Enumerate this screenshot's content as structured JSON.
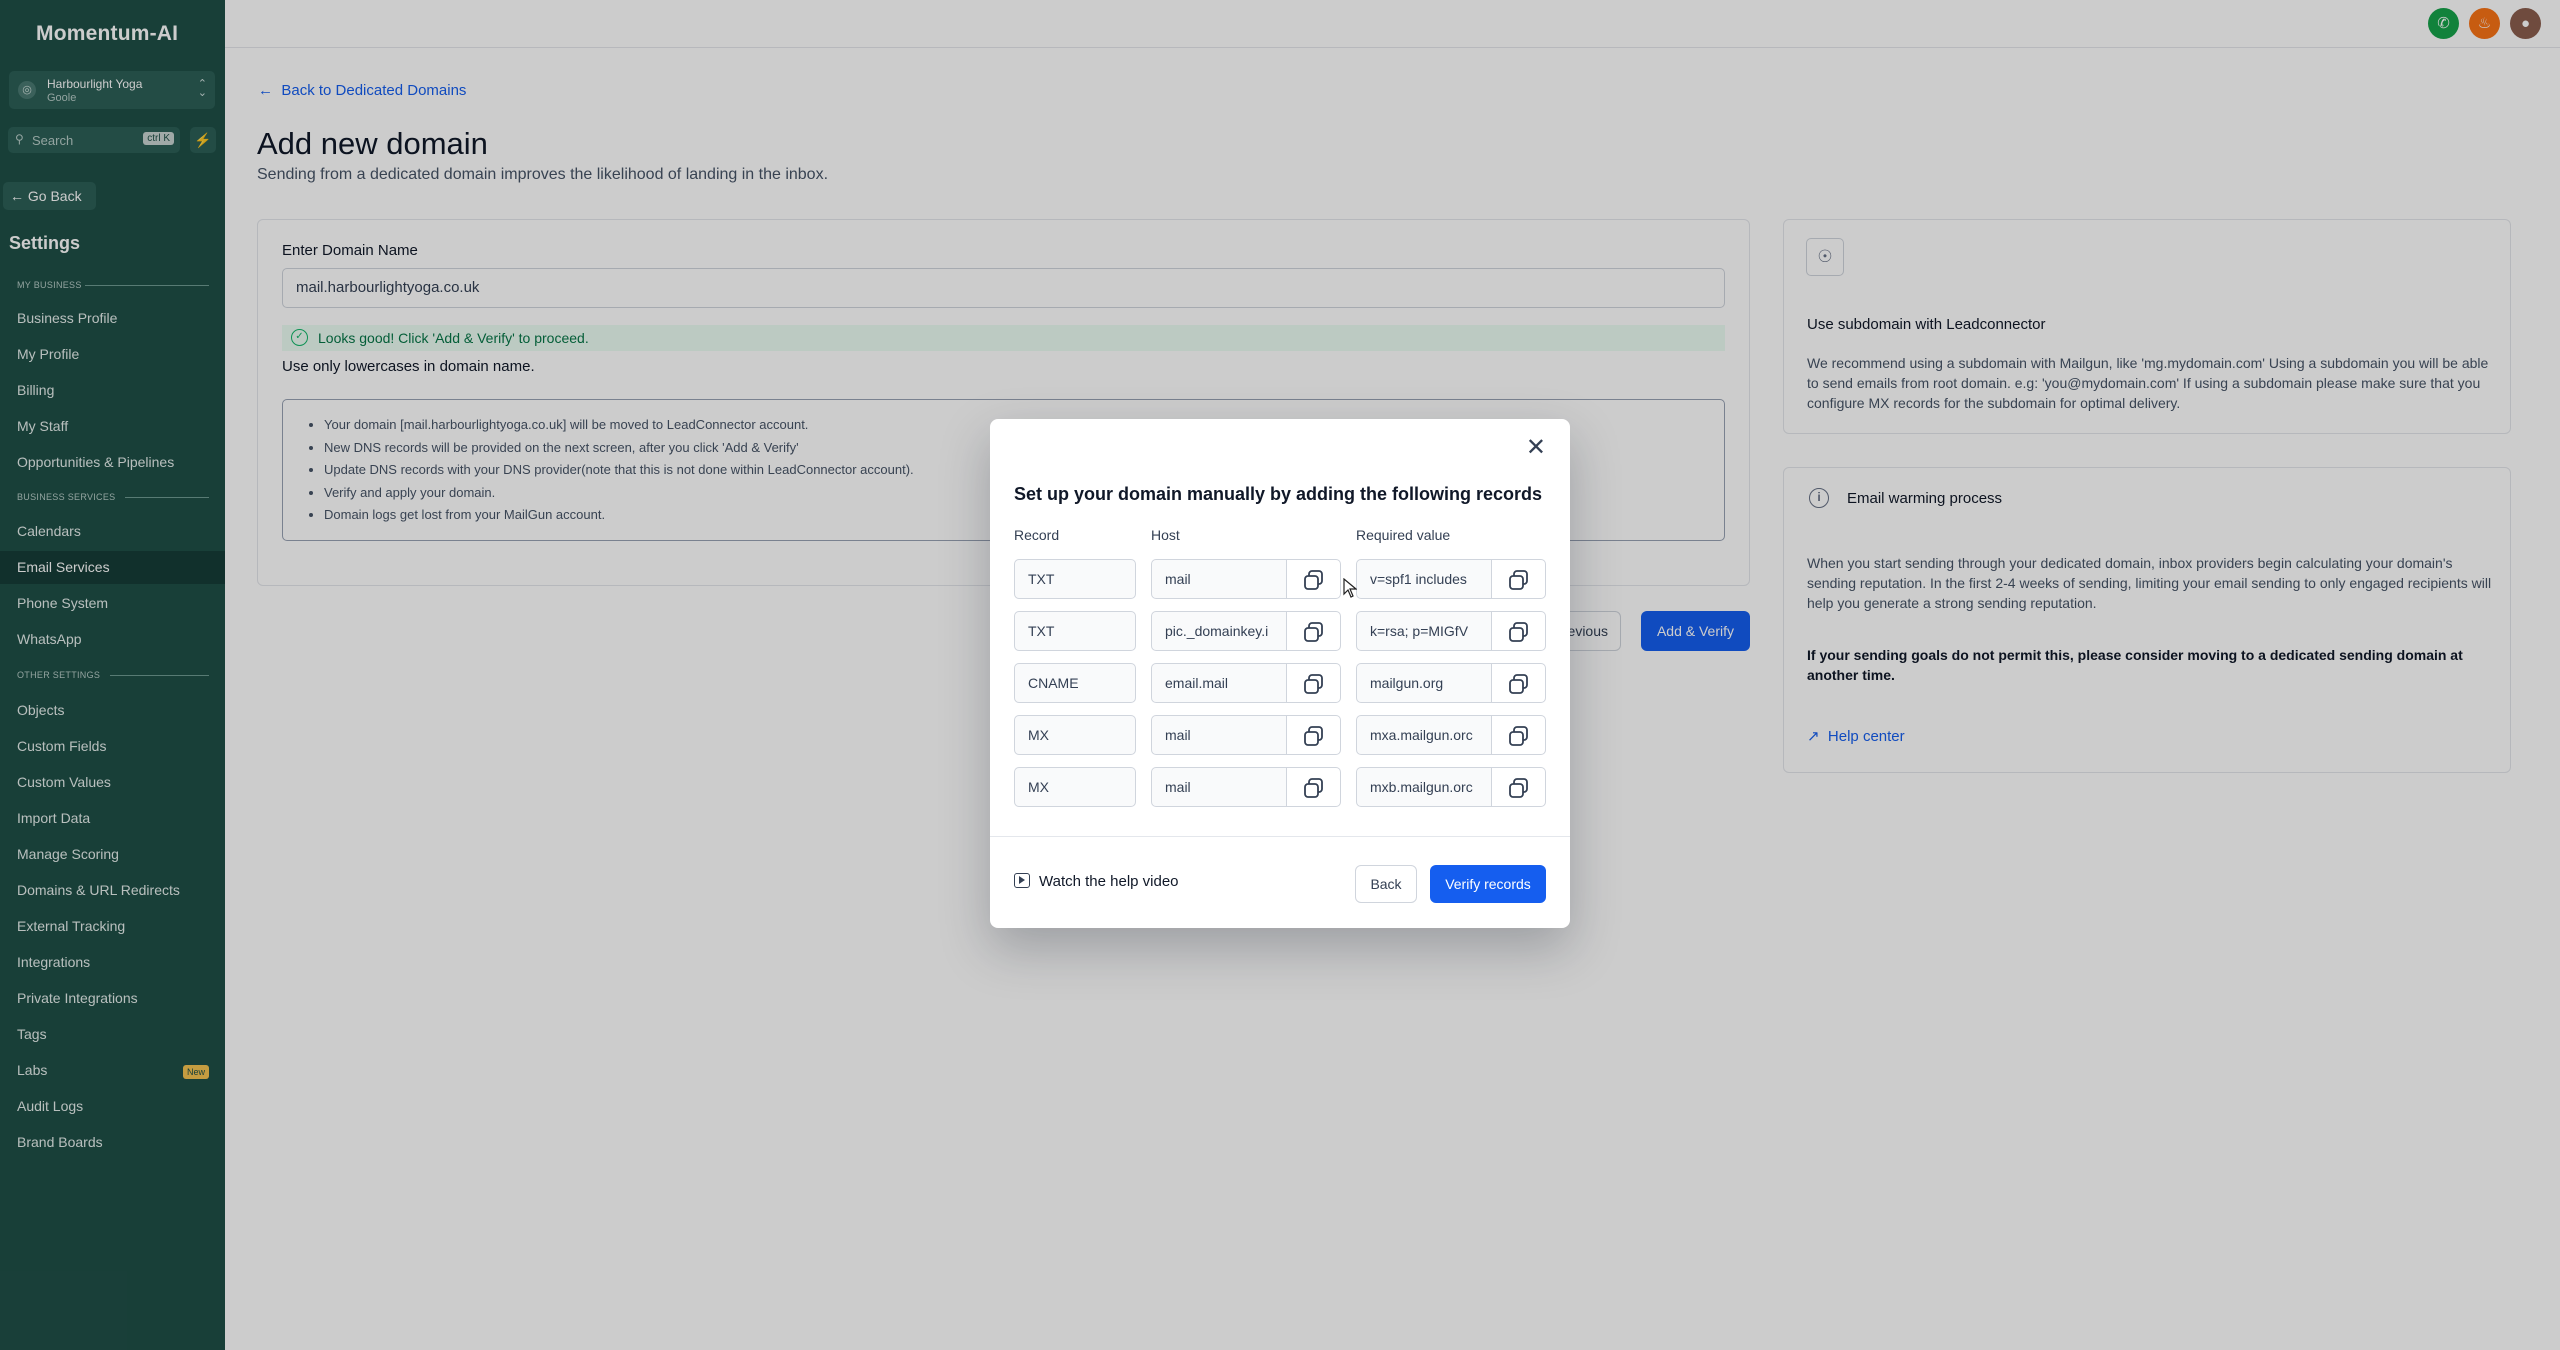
{
  "app": {
    "logo": "Momentum-AI"
  },
  "account": {
    "name": "Harbourlight Yoga",
    "sub": "Goole"
  },
  "search": {
    "placeholder": "Search",
    "shortcut": "ctrl K"
  },
  "sidebar": {
    "go_back": "Go Back",
    "title": "Settings",
    "sections": {
      "my_business": "MY BUSINESS",
      "business_services": "BUSINESS SERVICES",
      "other_settings": "OTHER SETTINGS"
    },
    "items": {
      "business_profile": "Business Profile",
      "my_profile": "My Profile",
      "billing": "Billing",
      "my_staff": "My Staff",
      "opportunities": "Opportunities & Pipelines",
      "calendars": "Calendars",
      "email_services": "Email Services",
      "phone_system": "Phone System",
      "whatsapp": "WhatsApp",
      "objects": "Objects",
      "custom_fields": "Custom Fields",
      "custom_values": "Custom Values",
      "import_data": "Import Data",
      "manage_scoring": "Manage Scoring",
      "domains": "Domains & URL Redirects",
      "external_tracking": "External Tracking",
      "integrations": "Integrations",
      "private_integrations": "Private Integrations",
      "tags": "Tags",
      "labs": "Labs",
      "audit_logs": "Audit Logs",
      "brand_boards": "Brand Boards"
    },
    "labs_badge": "New"
  },
  "page": {
    "back_link": "Back to Dedicated Domains",
    "title": "Add new domain",
    "subtitle": "Sending from a dedicated domain improves the likelihood of landing in the inbox.",
    "domain_label": "Enter Domain Name",
    "domain_value": "mail.harbourlightyoga.co.uk",
    "success_msg": "Looks good! Click 'Add & Verify' to proceed.",
    "lowercase_msg": "Use only lowercases in domain name.",
    "notes": [
      "Your domain [mail.harbourlightyoga.co.uk] will be moved to LeadConnector account.",
      "New DNS records will be provided on the next screen, after you click 'Add & Verify'",
      "Update DNS records with your DNS provider(note that this is not done within LeadConnector account).",
      "Verify and apply your domain.",
      "Domain logs get lost from your MailGun account."
    ],
    "previous_btn": "evious",
    "add_verify_btn": "Add & Verify"
  },
  "side_panel": {
    "subdomain_title": "Use subdomain with Leadconnector",
    "subdomain_text": "We recommend using a subdomain with Mailgun, like 'mg.mydomain.com' Using a subdomain you will be able to send emails from root domain. e.g: 'you@mydomain.com' If using a subdomain please make sure that you configure MX records for the subdomain for optimal delivery.",
    "warming_title": "Email warming process",
    "warming_text": "When you start sending through your dedicated domain, inbox providers begin calculating your domain's sending reputation. In the first 2-4 weeks of sending, limiting your email sending to only engaged recipients will help you generate a strong sending reputation.",
    "warming_bold": "If your sending goals do not permit this, please consider moving to a dedicated sending domain at another time.",
    "help_center": "Help center"
  },
  "modal": {
    "title": "Set up your domain manually by adding the following records",
    "columns": {
      "record": "Record",
      "host": "Host",
      "value": "Required value"
    },
    "records": [
      {
        "type": "TXT",
        "host": "mail",
        "value": "v=spf1 includes"
      },
      {
        "type": "TXT",
        "host": "pic._domainkey.i",
        "value": "k=rsa; p=MIGfV"
      },
      {
        "type": "CNAME",
        "host": "email.mail",
        "value": "mailgun.org"
      },
      {
        "type": "MX",
        "host": "mail",
        "value": "mxa.mailgun.orc"
      },
      {
        "type": "MX",
        "host": "mail",
        "value": "mxb.mailgun.orc"
      }
    ],
    "watch_video": "Watch the help video",
    "back_btn": "Back",
    "verify_btn": "Verify records"
  },
  "colors": {
    "sidebar": "#1f4f47",
    "primary": "#155eef",
    "success": "#12b76a"
  },
  "icons": [
    "search-icon",
    "lightning-icon",
    "arrow-left-icon",
    "phone-icon",
    "bell-icon",
    "avatar",
    "check-circle-icon",
    "bulb-icon",
    "info-icon",
    "external-link-icon",
    "close-icon",
    "copy-icon",
    "play-icon"
  ]
}
